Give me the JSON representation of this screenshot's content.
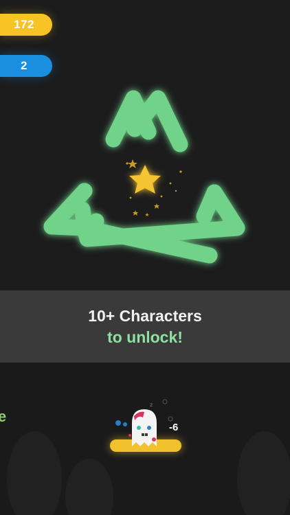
{
  "hud": {
    "score": "172",
    "level": "2",
    "score_color": "#f7c325",
    "level_color": "#1a8fe0"
  },
  "character": {
    "shape_color": "#6fd389",
    "star_color": "#f5c433",
    "icon": "star-icon"
  },
  "banner": {
    "line1": "10+ Characters",
    "line2": "to unlock!",
    "text_color": "#f2f2f2",
    "highlight_color": "#8fe0a2"
  },
  "gameplay": {
    "edge_letter": "e",
    "damage_text": "-6",
    "platform_color": "#f2c12e",
    "player_icon": "ghost-icon"
  }
}
